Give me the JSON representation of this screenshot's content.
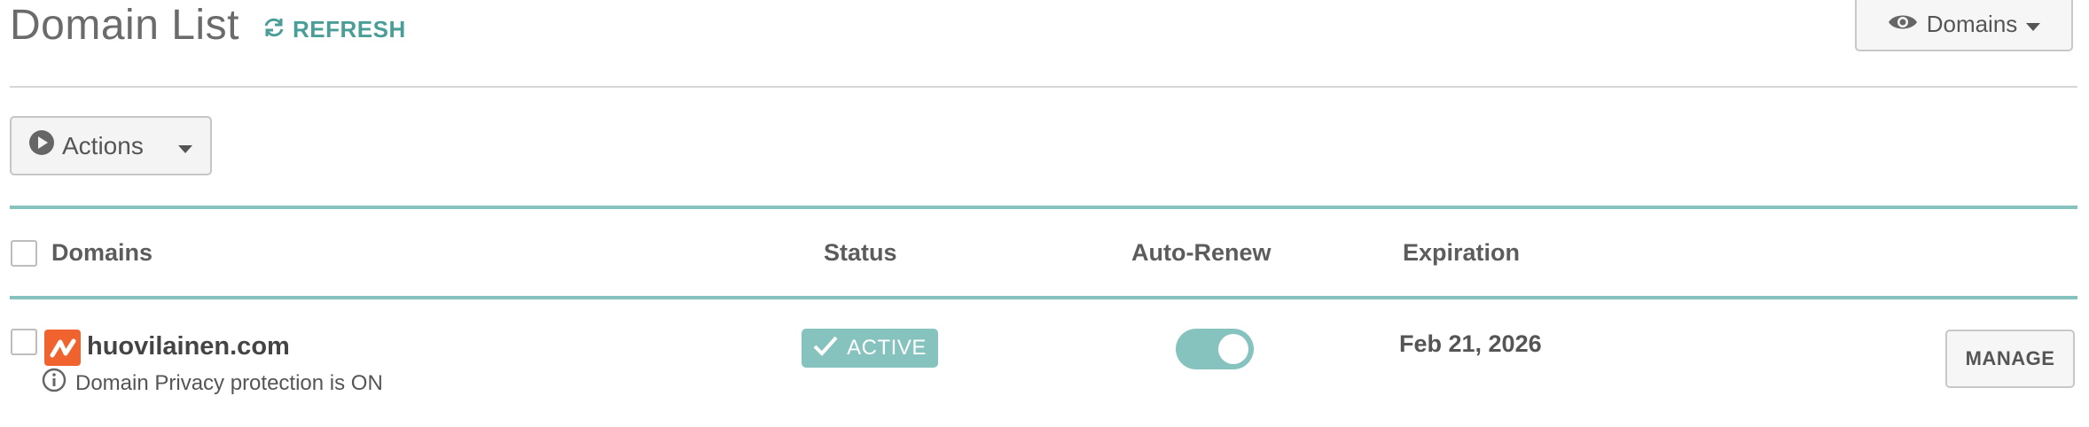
{
  "header": {
    "title": "Domain List",
    "refresh_label": "REFRESH",
    "view_select_label": "Domains"
  },
  "toolbar": {
    "actions_label": "Actions"
  },
  "table": {
    "columns": {
      "domains": "Domains",
      "status": "Status",
      "auto_renew": "Auto-Renew",
      "expiration": "Expiration"
    },
    "rows": [
      {
        "domain": "huovilainen.com",
        "privacy_note": "Domain Privacy protection is ON",
        "status": "ACTIVE",
        "auto_renew": true,
        "expiration": "Feb 21, 2026",
        "manage_label": "MANAGE"
      }
    ]
  },
  "colors": {
    "accent_teal": "#86c3bf",
    "refresh_teal": "#4a9e98",
    "logo_orange": "#f0632f"
  },
  "icons": {
    "refresh": "refresh-icon",
    "view": "eye-icon",
    "actions": "play-circle-icon",
    "privacy": "info-icon",
    "status": "checkmark-icon"
  }
}
